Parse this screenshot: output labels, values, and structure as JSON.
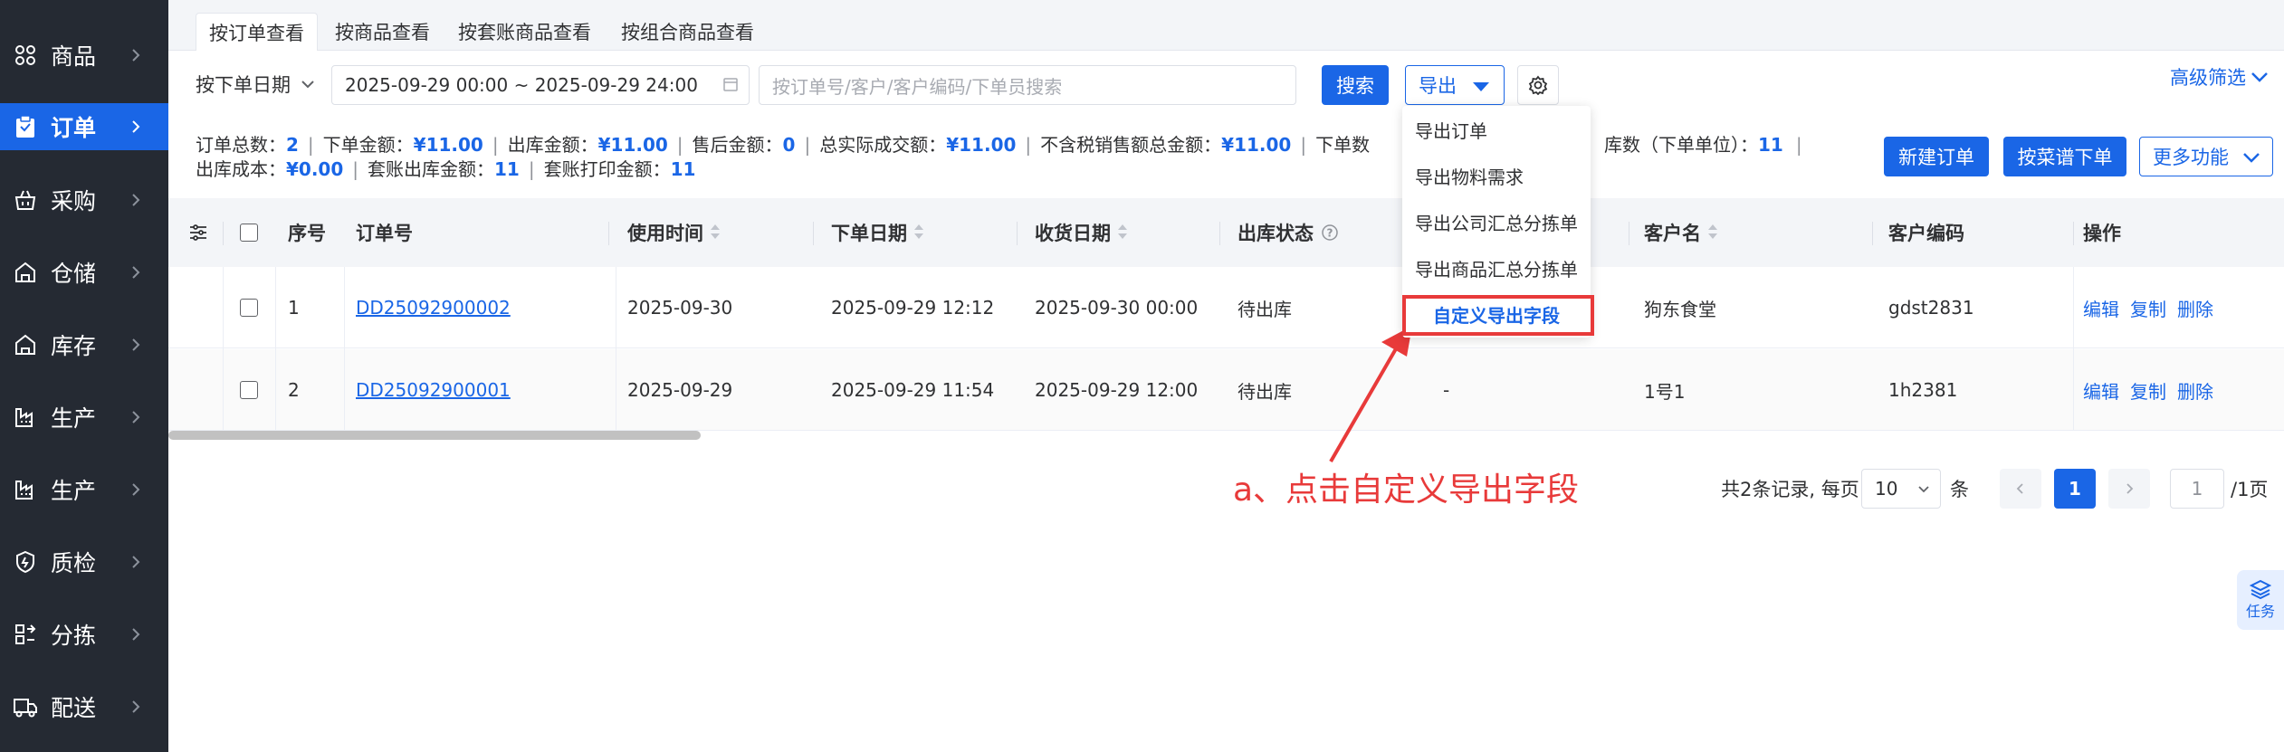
{
  "sidebar": {
    "items": [
      {
        "label": "商品",
        "icon": "grid-icon"
      },
      {
        "label": "订单",
        "icon": "clipboard-icon",
        "active": true
      },
      {
        "label": "采购",
        "icon": "basket-icon"
      },
      {
        "label": "仓储",
        "icon": "warehouse-icon"
      },
      {
        "label": "库存",
        "icon": "store-icon"
      },
      {
        "label": "生产",
        "icon": "factory-icon"
      },
      {
        "label": "生产",
        "icon": "factory-icon"
      },
      {
        "label": "质检",
        "icon": "shield-icon"
      },
      {
        "label": "分拣",
        "icon": "sort-icon"
      },
      {
        "label": "配送",
        "icon": "truck-icon"
      }
    ]
  },
  "tabs": [
    "按订单查看",
    "按商品查看",
    "按套账商品查看",
    "按组合商品查看"
  ],
  "filter": {
    "date_type": "按下单日期",
    "date_range": "2025-09-29 00:00 ~ 2025-09-29 24:00",
    "search_placeholder": "按订单号/客户/客户编码/下单员搜索",
    "search_button": "搜索",
    "export_button": "导出",
    "advanced_filter": "高级筛选"
  },
  "summary": {
    "line1": [
      {
        "label": "订单总数：",
        "value": "2"
      },
      {
        "label": "下单金额：",
        "value": "¥11.00"
      },
      {
        "label": "出库金额：",
        "value": "¥11.00"
      },
      {
        "label": "售后金额：",
        "value": "0"
      },
      {
        "label": "总实际成交额：",
        "value": "¥11.00"
      },
      {
        "label": "不含税销售额总金额：",
        "value": "¥11.00"
      },
      {
        "label": "下单数",
        "value": ""
      }
    ],
    "line1_tail_label": "库数（下单单位）：",
    "line1_tail_value": "11",
    "line2": [
      {
        "label": "出库成本：",
        "value": "¥0.00"
      },
      {
        "label": "套账出库金额：",
        "value": "11"
      },
      {
        "label": "套账打印金额：",
        "value": "11"
      }
    ]
  },
  "actions": {
    "new_order": "新建订单",
    "recipe_order": "按菜谱下单",
    "more": "更多功能"
  },
  "table": {
    "headers": {
      "seq": "序号",
      "order_no": "订单号",
      "use_time": "使用时间",
      "order_date": "下单日期",
      "receive_date": "收货日期",
      "stock_status": "出库状态",
      "customer_name": "客户名",
      "customer_code": "客户编码",
      "ops": "操作"
    },
    "rows": [
      {
        "seq": "1",
        "order_no": "DD25092900002",
        "use_time": "2025-09-30",
        "order_date": "2025-09-29 12:12",
        "receive_date": "2025-09-30 00:00",
        "stock_status": "待出库",
        "mid": "",
        "customer_name": "狗东食堂",
        "customer_code": "gdst2831",
        "ops": [
          "编辑",
          "复制",
          "删除"
        ]
      },
      {
        "seq": "2",
        "order_no": "DD25092900001",
        "use_time": "2025-09-29",
        "order_date": "2025-09-29 11:54",
        "receive_date": "2025-09-29 12:00",
        "stock_status": "待出库",
        "mid": "-",
        "customer_name": "1号1",
        "customer_code": "1h2381",
        "ops": [
          "编辑",
          "复制",
          "删除"
        ]
      }
    ]
  },
  "export_menu": {
    "items": [
      "导出订单",
      "导出物料需求",
      "导出公司汇总分拣单",
      "导出商品汇总分拣单",
      "自定义导出字段"
    ]
  },
  "annotation": "a、点击自定义导出字段",
  "pagination": {
    "total_text": "共2条记录, 每页",
    "page_size": "10",
    "unit": "条",
    "current": "1",
    "jump_value": "1",
    "total_pages": "/1页"
  },
  "task_tab": "任务",
  "colors": {
    "accent": "#1a66e6",
    "sidebar": "#252a33",
    "annotation": "#e83a3a"
  }
}
